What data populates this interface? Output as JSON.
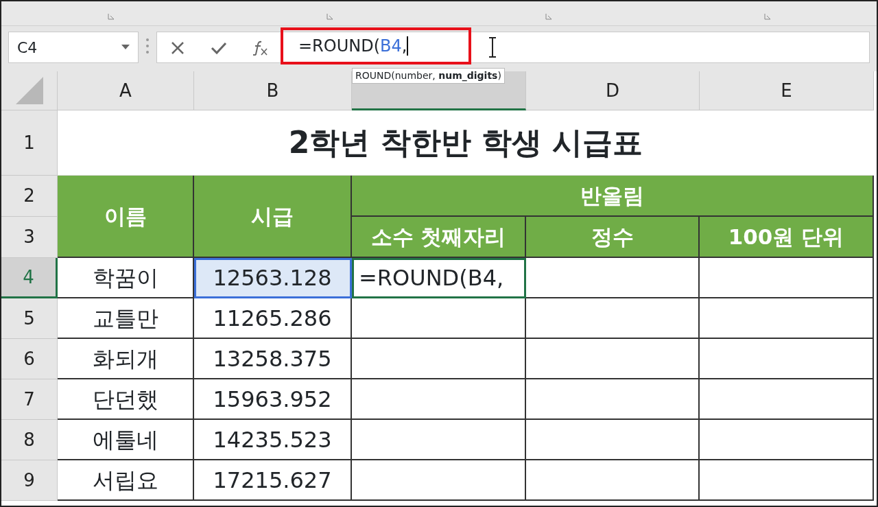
{
  "name_box": "C4",
  "formula": [
    {
      "kind": "plain",
      "text": "=ROUND("
    },
    {
      "kind": "ref",
      "text": "B4"
    },
    {
      "kind": "plain",
      "text": ","
    }
  ],
  "tooltip": "ROUND(number, **num_digits**)",
  "columns": [
    {
      "label": "A",
      "selected": false
    },
    {
      "label": "B",
      "selected": false
    },
    {
      "selected": true
    },
    {
      "label": "D",
      "selected": false
    },
    {
      "label": "E",
      "selected": false
    }
  ],
  "row_headers": [
    {
      "label": "1",
      "selected": false
    },
    {
      "label": "2",
      "selected": false
    },
    {
      "label": "3",
      "selected": false
    },
    {
      "label": "4",
      "selected": true
    },
    {
      "label": "5",
      "selected": false
    },
    {
      "label": "6",
      "selected": false
    },
    {
      "label": "7",
      "selected": false
    },
    {
      "label": "8",
      "selected": false
    },
    {
      "label": "9",
      "selected": false
    }
  ],
  "title": "2학년 착한반 학생 시급표",
  "headers": {
    "name": "이름",
    "wage": "시급",
    "group": "반올림",
    "sub": [
      "소수 첫째자리",
      "정수",
      "100원 단위"
    ]
  },
  "rows": [
    {
      "name": "학꿈이",
      "wage": "12563.128",
      "referenced": true,
      "editing": "=ROUND(B4,"
    },
    {
      "name": "교틀만",
      "wage": "11265.286",
      "referenced": false
    },
    {
      "name": "화되개",
      "wage": "13258.375",
      "referenced": false
    },
    {
      "name": "단던했",
      "wage": "15963.952",
      "referenced": false
    },
    {
      "name": "에툴네",
      "wage": "14235.523",
      "referenced": false
    },
    {
      "name": "서립요",
      "wage": "17215.627",
      "referenced": false
    }
  ]
}
